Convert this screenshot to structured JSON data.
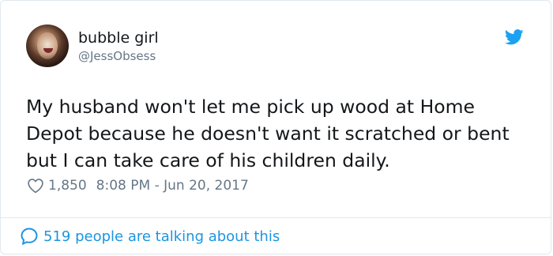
{
  "user": {
    "display_name": "bubble girl",
    "handle": "@JessObsess"
  },
  "tweet": {
    "text": "My husband won't let me pick up wood at Home Depot because he doesn't want it scratched or bent but I can take care of his children daily.",
    "likes": "1,850",
    "timestamp": "8:08 PM - Jun 20, 2017"
  },
  "footer": {
    "talking": "519 people are talking about this"
  },
  "icons": {
    "brand": "twitter-bird-icon",
    "like": "heart-icon",
    "reply": "speech-bubble-icon"
  },
  "colors": {
    "accent": "#1da1f2",
    "link": "#1b95e0",
    "muted": "#657786",
    "text": "#14171a",
    "border": "#e1e8ed"
  }
}
